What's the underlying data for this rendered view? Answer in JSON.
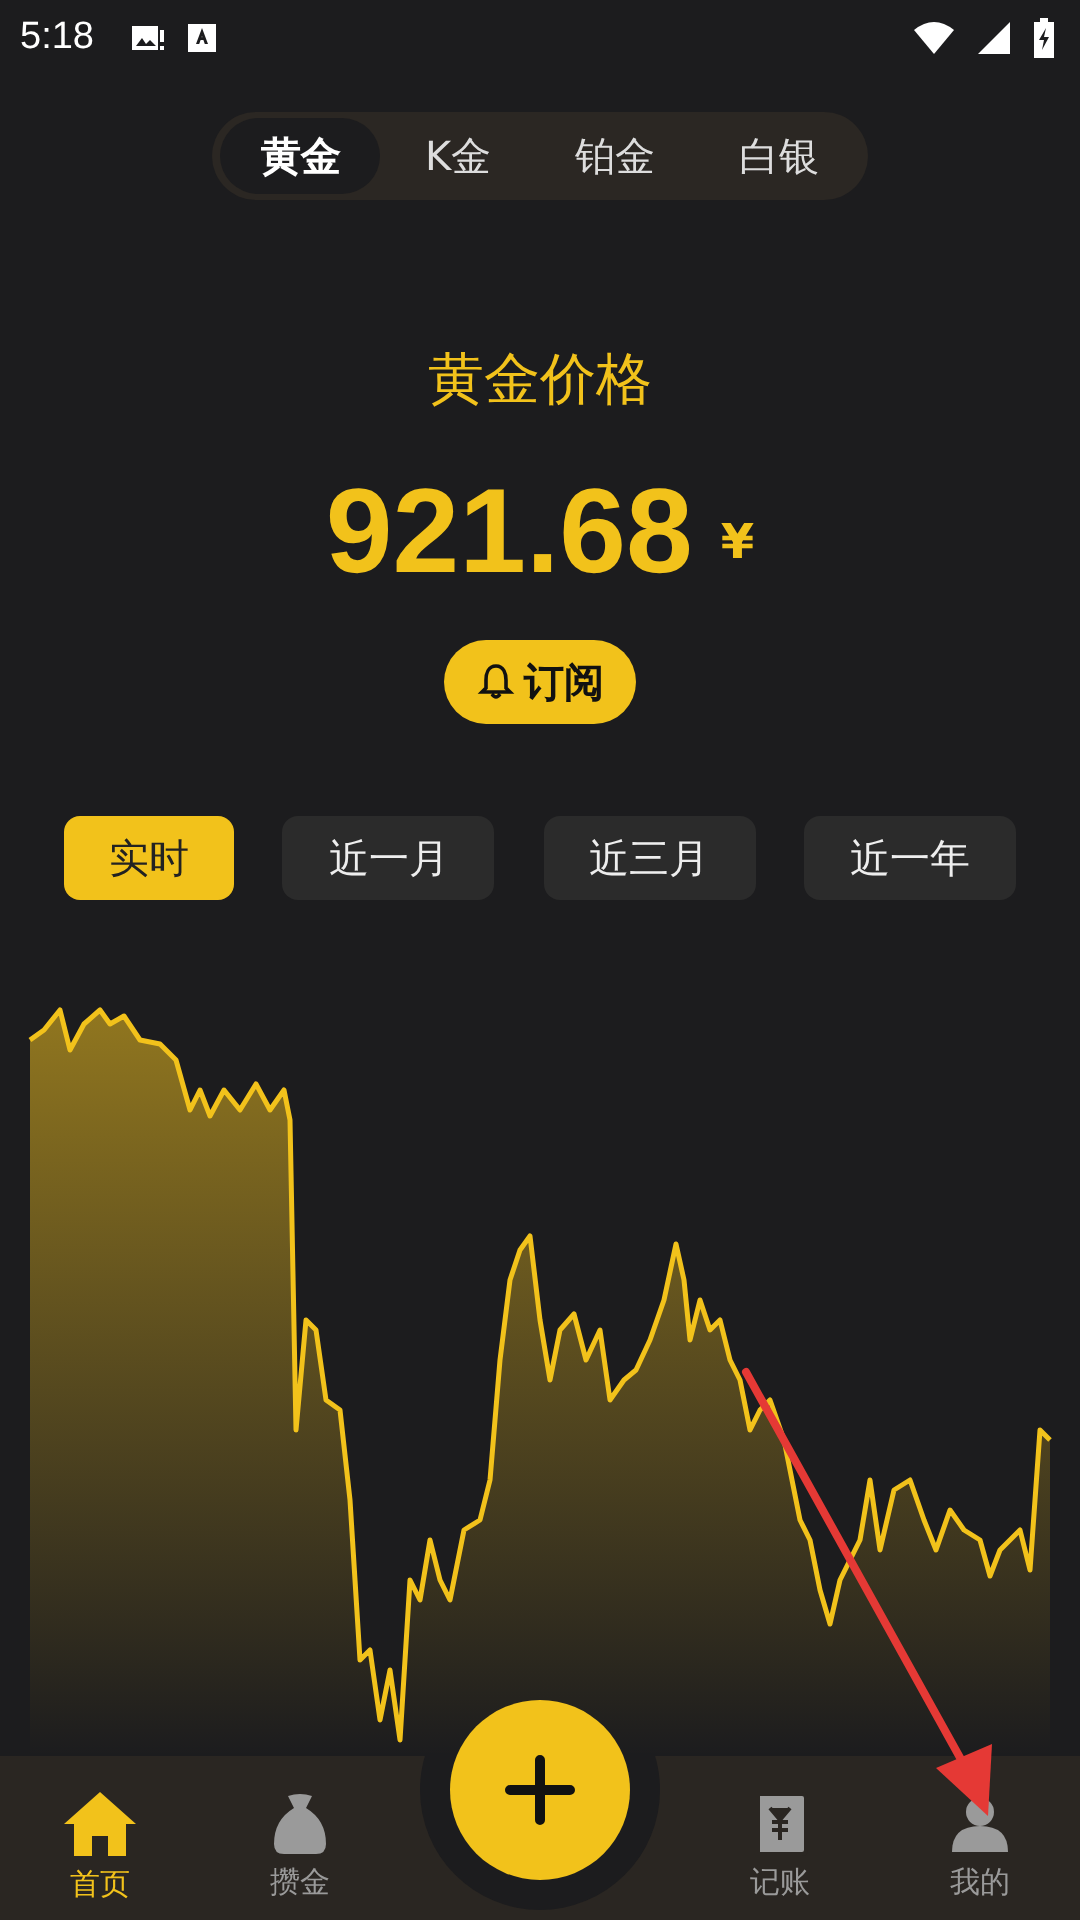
{
  "status_bar": {
    "time": "5:18"
  },
  "metal_tabs": [
    {
      "label": "黄金",
      "selected": true
    },
    {
      "label": "K金",
      "selected": false
    },
    {
      "label": "铂金",
      "selected": false
    },
    {
      "label": "白银",
      "selected": false
    }
  ],
  "price": {
    "title": "黄金价格",
    "value": "921.68",
    "currency": "¥"
  },
  "subscribe_button": {
    "label": "订阅"
  },
  "periods": [
    {
      "label": "实时",
      "selected": true
    },
    {
      "label": "近一月",
      "selected": false
    },
    {
      "label": "近三月",
      "selected": false
    },
    {
      "label": "近一年",
      "selected": false
    }
  ],
  "nav": [
    {
      "label": "首页",
      "kind": "home",
      "selected": true
    },
    {
      "label": "攒金",
      "kind": "bag",
      "selected": false
    },
    {
      "label": "记账",
      "kind": "ledger",
      "selected": false
    },
    {
      "label": "我的",
      "kind": "person",
      "selected": false
    }
  ],
  "annotation": {
    "kind": "arrow",
    "color": "#e53935"
  }
}
